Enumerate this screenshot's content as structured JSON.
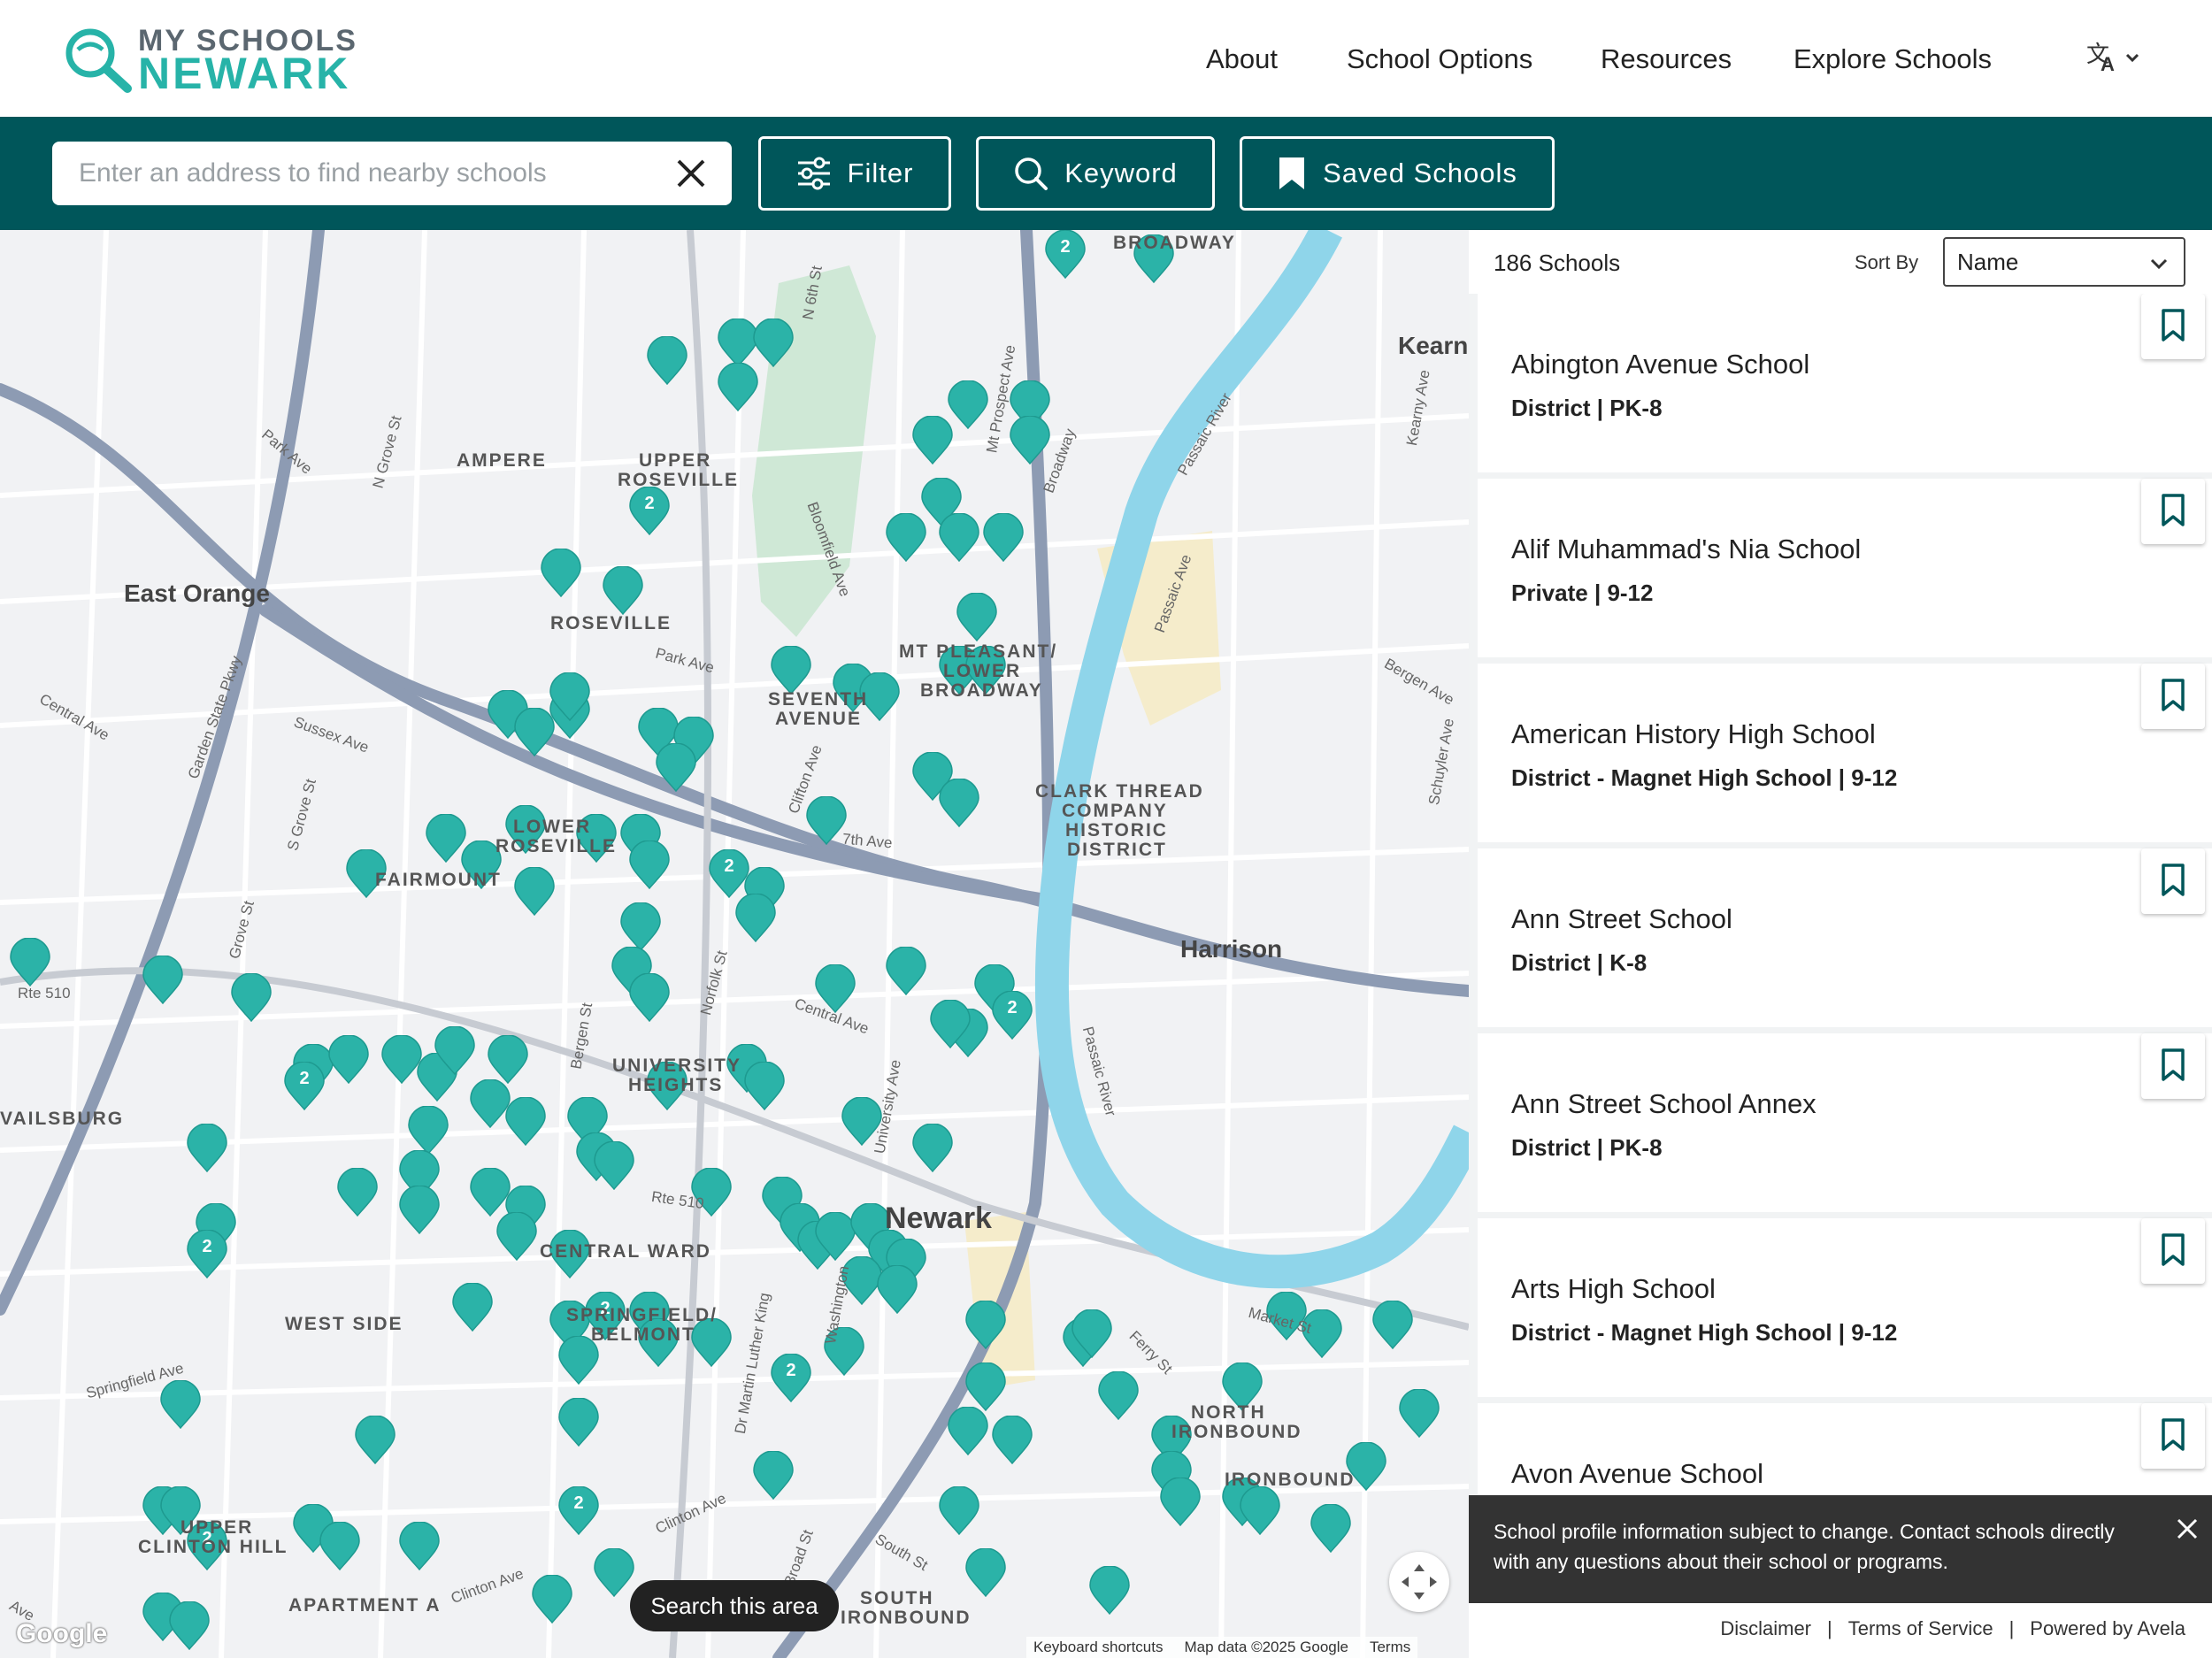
{
  "header": {
    "logo_top": "MY SCHOOLS",
    "logo_bottom": "NEWARK",
    "nav": [
      "About",
      "School Options",
      "Resources",
      "Explore Schools"
    ],
    "language_icon": "translate-icon"
  },
  "toolbar": {
    "search_placeholder": "Enter an address to find nearby schools",
    "search_value": "",
    "filter_label": "Filter",
    "keyword_label": "Keyword",
    "saved_label": "Saved Schools"
  },
  "map": {
    "neighborhoods": [
      "AMPERE",
      "UPPER",
      "ROSEVILLE",
      "ROSEVILLE",
      "MT PLEASANT/",
      "LOWER",
      "BROADWAY",
      "SEVENTH",
      "AVENUE",
      "CLARK THREAD",
      "COMPANY",
      "HISTORIC",
      "DISTRICT",
      "LOWER",
      "ROSEVILLE",
      "FAIRMOUNT",
      "UNIVERSITY",
      "HEIGHTS",
      "CENTRAL WARD",
      "WEST SIDE",
      "SPRINGFIELD/",
      "BELMONT",
      "NORTH",
      "IRONBOUND",
      "IRONBOUND",
      "UPPER",
      "CLINTON HILL",
      "APARTMENT A",
      "SOUTH",
      "IRONBOUND",
      "VAILSBURG",
      "BROADWAY"
    ],
    "cities": [
      "East Orange",
      "Harrison",
      "Newark",
      "Kearn"
    ],
    "streets": [
      "N 6th St",
      "Park Ave",
      "N Grove St",
      "Bloomfield Ave",
      "Mt Prospect Ave",
      "Broadway",
      "Passaic River",
      "Passaic Ave",
      "Kearny Ave",
      "Garden State Pkwy",
      "Central Ave",
      "Sussex Ave",
      "S Grove St",
      "Park Ave",
      "Clifton Ave",
      "7th Ave",
      "Bergen Ave",
      "Schuyler Ave",
      "Grove St",
      "Rte 510",
      "Bergen St",
      "Norfolk St",
      "Central Ave",
      "University Ave",
      "Rte 510",
      "Springfield Ave",
      "Dr Martin Luther King",
      "Washington",
      "Ferry St",
      "Market St",
      "Passaic River",
      "Clinton Ave",
      "Broad St",
      "South St",
      "Clinton Ave",
      "Ave"
    ],
    "search_area_label": "Search this area",
    "google_label": "Google",
    "attribution": [
      "Keyboard shortcuts",
      "Map data ©2025 Google",
      "Terms"
    ],
    "cluster_counts": [
      "2",
      "2",
      "2",
      "2",
      "2",
      "2",
      "2",
      "2",
      "2",
      "2"
    ],
    "accent_color": "#2bb3a8"
  },
  "list": {
    "count_label": "186 Schools",
    "sort_label": "Sort By",
    "sort_value": "Name",
    "schools": [
      {
        "name": "Abington Avenue School",
        "meta": "District | PK-8"
      },
      {
        "name": "Alif Muhammad's Nia School",
        "meta": "Private | 9-12"
      },
      {
        "name": "American History High School",
        "meta": "District - Magnet High School | 9-12"
      },
      {
        "name": "Ann Street School",
        "meta": "District | K-8"
      },
      {
        "name": "Ann Street School Annex",
        "meta": "District | PK-8"
      },
      {
        "name": "Arts High School",
        "meta": "District - Magnet High School | 9-12"
      },
      {
        "name": "Avon Avenue School",
        "meta": ""
      }
    ]
  },
  "notice": {
    "text": "School profile information subject to change. Contact schools directly with any questions about their school or programs."
  },
  "footer": {
    "links": [
      "Disclaimer",
      "Terms of Service",
      "Powered by Avela"
    ]
  }
}
